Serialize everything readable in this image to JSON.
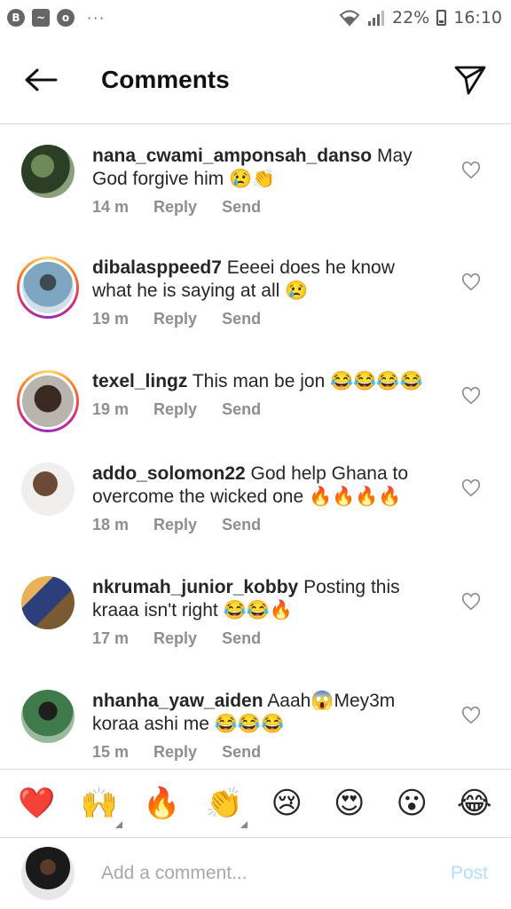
{
  "status_bar": {
    "left_icons": [
      "B",
      "~",
      "o"
    ],
    "dots": "···",
    "battery": "22%",
    "time": "16:10"
  },
  "header": {
    "title": "Comments"
  },
  "comments": [
    {
      "username": "nana_cwami_amponsah_danso",
      "text": "May God forgive him 😢👏",
      "time": "14 m",
      "reply": "Reply",
      "send": "Send",
      "ring": false,
      "avatar_color": "#3b5a2f"
    },
    {
      "username": "dibalasppeed7",
      "text": "Eeeei does he know what he is saying at all 😢",
      "time": "19 m",
      "reply": "Reply",
      "send": "Send",
      "ring": true,
      "avatar_color": "#4a7a9a"
    },
    {
      "username": "texel_lingz",
      "text": "This man be jon 😂😂😂😂",
      "time": "19 m",
      "reply": "Reply",
      "send": "Send",
      "ring": true,
      "avatar_color": "#3a2a22"
    },
    {
      "username": "addo_solomon22",
      "text": "God help Ghana to overcome the wicked one 🔥🔥🔥🔥",
      "time": "18 m",
      "reply": "Reply",
      "send": "Send",
      "ring": false,
      "avatar_color": "#6b4a38"
    },
    {
      "username": "nkrumah_junior_kobby",
      "text": "Posting this kraaa isn't right 😂😂🔥",
      "time": "17 m",
      "reply": "Reply",
      "send": "Send",
      "ring": false,
      "avatar_color": "#7a5a30"
    },
    {
      "username": "nhanha_yaw_aiden",
      "text": "Aaah😱Mey3m koraa ashi me 😂😂😂",
      "time": "15 m",
      "reply": "Reply",
      "send": "Send",
      "ring": false,
      "avatar_color": "#2f5a3a"
    }
  ],
  "emoji_bar": [
    "❤️",
    "🙌",
    "🔥",
    "👏",
    "😢",
    "😍",
    "😮",
    "😂"
  ],
  "composer": {
    "placeholder": "Add a comment...",
    "post_label": "Post"
  },
  "colors": {
    "text": "#262626",
    "meta": "#8e8e8e",
    "divider": "#dbdbdb",
    "post_disabled": "#b2dffc"
  }
}
